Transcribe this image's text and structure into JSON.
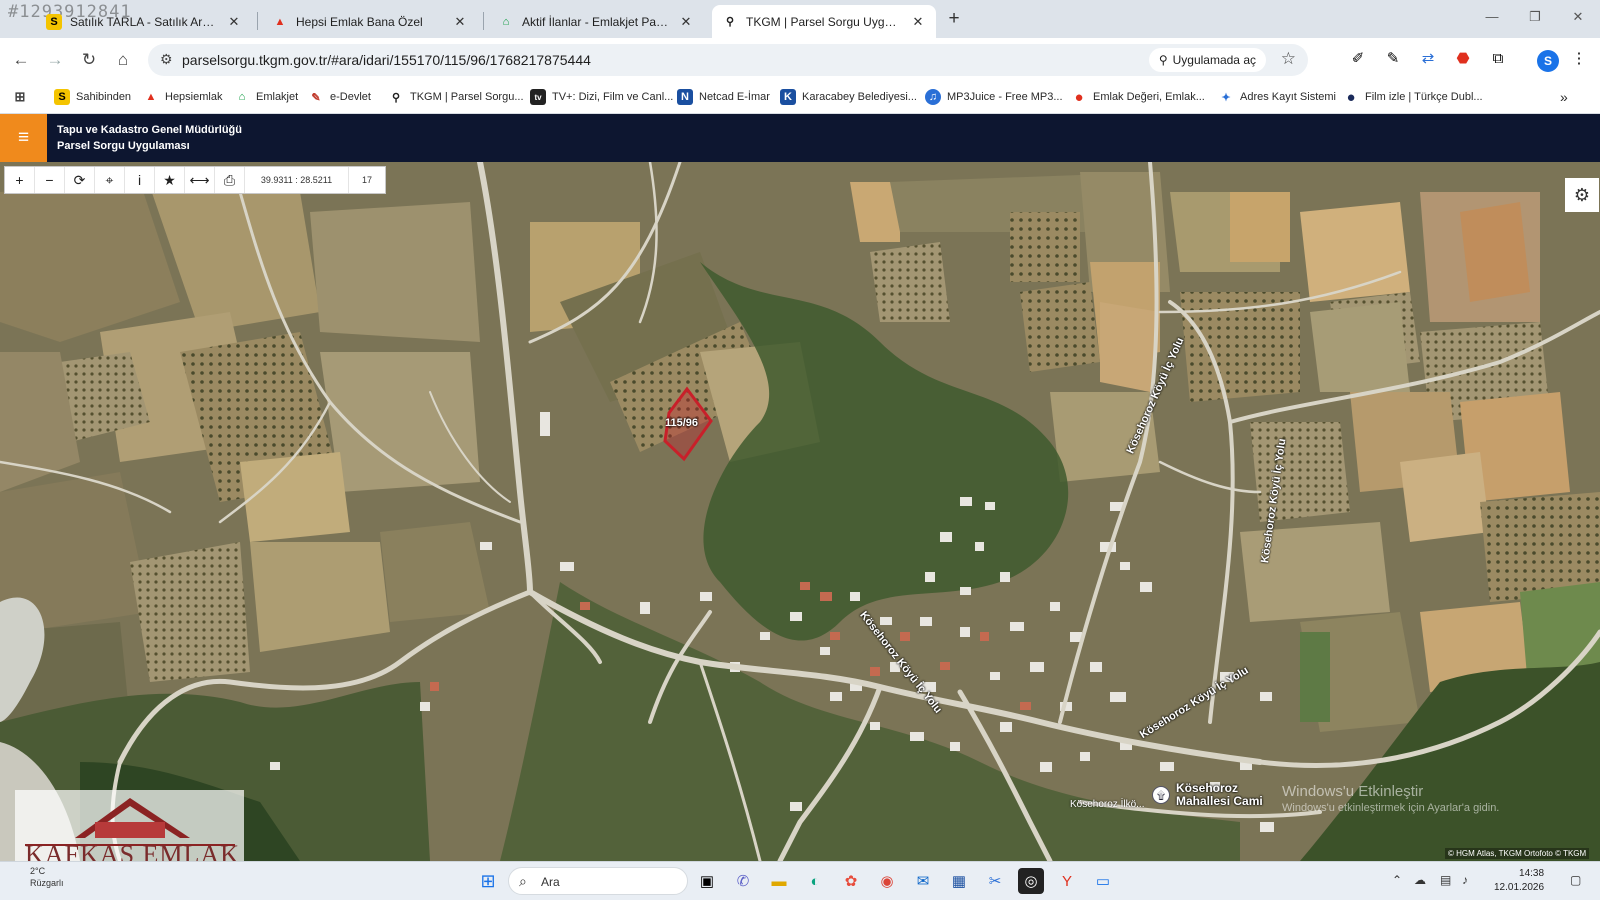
{
  "watermark_id": "#1293912841",
  "tabs": [
    {
      "title": "Satılık TARLA - Satılık Arsa İlanları",
      "favicon": "S",
      "color": "#f4c400"
    },
    {
      "title": "Hepsi Emlak Bana Özel",
      "favicon": "^",
      "color": "#e0301e"
    },
    {
      "title": "Aktif İlanlar - Emlakjet Panel",
      "favicon": "⌂",
      "color": "#0a9a3d"
    },
    {
      "title": "TKGM | Parsel Sorgu Uygulaması",
      "favicon": "⚲",
      "color": "#222222"
    }
  ],
  "toolbar": {
    "url": "parselsorgu.tkgm.gov.tr/#ara/idari/155170/115/96/1768217875444",
    "open_in_app": "Uygulamada aç",
    "profile_initial": "S"
  },
  "bookmarks": [
    {
      "label": "Sahibinden",
      "icon": "S",
      "color": "#f4c400"
    },
    {
      "label": "Hepsiemlak",
      "icon": "^",
      "color": "#e0301e"
    },
    {
      "label": "Emlakjet",
      "icon": "⌂",
      "color": "#0a9a3d"
    },
    {
      "label": "e-Devlet",
      "icon": "✎",
      "color": "#c0392b"
    },
    {
      "label": "TKGM | Parsel Sorgu...",
      "icon": "⚲",
      "color": "#222222"
    },
    {
      "label": "TV+: Dizi, Film ve Canl...",
      "icon": "tv",
      "color": "#222222"
    },
    {
      "label": "Netcad E-İmar",
      "icon": "N",
      "color": "#1a4fa0"
    },
    {
      "label": "Karacabey Belediyesi...",
      "icon": "K",
      "color": "#1a4fa0"
    },
    {
      "label": "MP3Juice - Free MP3...",
      "icon": "♫",
      "color": "#2a6fd6"
    },
    {
      "label": "Emlak Değeri, Emlak...",
      "icon": "●",
      "color": "#e0301e"
    },
    {
      "label": "Adres Kayıt Sistemi",
      "icon": "✦",
      "color": "#2a6fd6"
    },
    {
      "label": "Film izle | Türkçe Dubl...",
      "icon": "●",
      "color": "#1a2a5a"
    }
  ],
  "app": {
    "title_line1": "Tapu ve Kadastro Genel Müdürlüğü",
    "title_line2": "Parsel Sorgu Uygulaması"
  },
  "map": {
    "coordinates": "39.9311 : 28.5211",
    "zoom_level": "17",
    "parcel_label": "115/96",
    "road_labels": [
      "Kösehoroz Köyü İç Yolu",
      "Kösehoroz Köyü İç Yolu",
      "Kösehoroz Köyü İç Yolu",
      "Kösehoroz Köyü İç Yolu"
    ],
    "mosque_line1": "Kösehoroz",
    "mosque_line2": "Mahallesi Cami",
    "school_label": "Kösehoroz İlkö...",
    "activate_windows_title": "Windows'u Etkinleştir",
    "activate_windows_sub": "Windows'u etkinleştirmek için Ayarlar'a gidin.",
    "attribution": "© HGM Atlas, TKGM Ortofoto © TKGM",
    "logo_text": "KAFKAS EMLAK",
    "parcel_color": "#c8202a"
  },
  "taskbar": {
    "weather_temp": "2°C",
    "weather_desc": "Rüzgarlı",
    "search_label": "Ara",
    "time": "14:38",
    "date": "12.01.2026"
  }
}
